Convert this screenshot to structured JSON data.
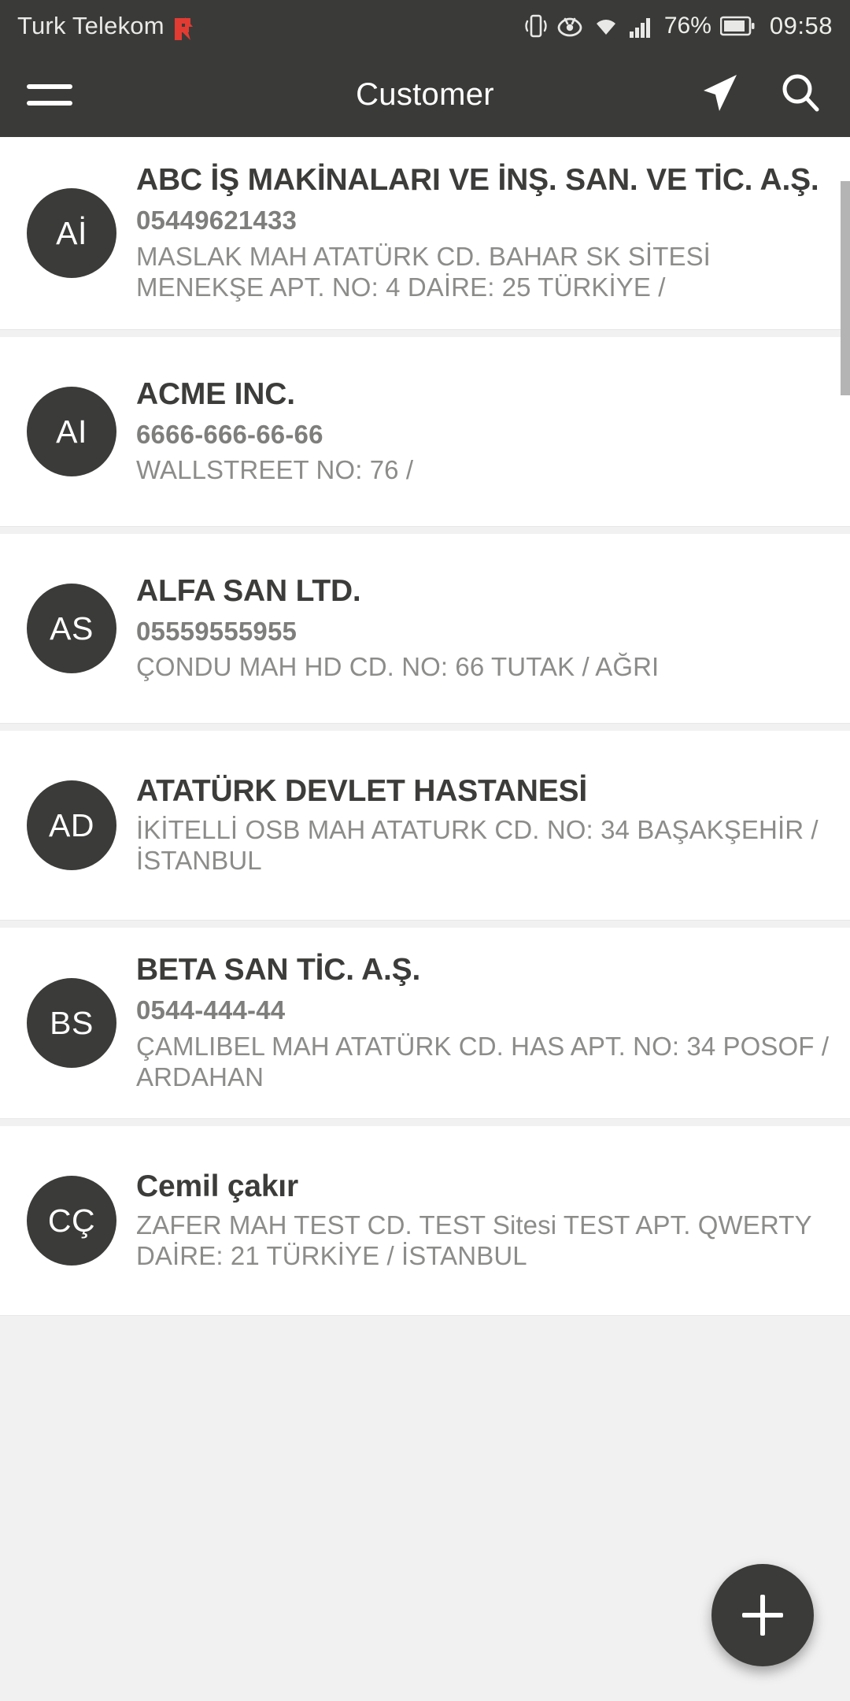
{
  "status_bar": {
    "carrier": "Turk Telekom",
    "carrier_badge_icon": "flash-f-icon",
    "icons": [
      "vibrate-icon",
      "eye-icon",
      "wifi-icon",
      "signal-bars-icon"
    ],
    "battery_percent": "76%",
    "battery_icon": "battery-icon",
    "time": "09:58"
  },
  "app_bar": {
    "menu_icon": "hamburger-menu-icon",
    "title": "Customer",
    "location_icon": "navigation-arrow-icon",
    "search_icon": "search-icon"
  },
  "fab": {
    "icon": "plus-icon",
    "label": "+"
  },
  "colors": {
    "app_bar_bg": "#3a3a38",
    "avatar_bg": "#3b3b39",
    "page_bg": "#f1f1f1",
    "card_bg": "#ffffff",
    "name_text": "#3c3c3a",
    "phone_text": "#7e7e7c",
    "address_text": "#8c8c8a",
    "carrier_badge": "#e23b32"
  },
  "customers": [
    {
      "initials": "Aİ",
      "name": "ABC İŞ MAKİNALARI VE İNŞ. SAN. VE TİC. A.Ş.",
      "phone": "05449621433",
      "address": "MASLAK MAH ATATÜRK CD. BAHAR  SK  SİTESİ MENEKŞE APT. NO: 4 DAİRE: 25 TÜRKİYE /"
    },
    {
      "initials": "AI",
      "name": "ACME INC.",
      "phone": "6666-666-66-66",
      "address": "WALLSTREET  NO: 76   /"
    },
    {
      "initials": "AS",
      "name": "ALFA SAN LTD.",
      "phone": "05559555955",
      "address": "ÇONDU MAH HD CD. NO: 66 TUTAK / AĞRI"
    },
    {
      "initials": "AD",
      "name": "ATATÜRK DEVLET HASTANESİ",
      "phone": "",
      "address": "İKİTELLİ OSB MAH ATATURK  CD. NO: 34 BAŞAKŞEHİR / İSTANBUL"
    },
    {
      "initials": "BS",
      "name": "BETA SAN TİC. A.Ş.",
      "phone": "0544-444-44",
      "address": "ÇAMLIBEL MAH ATATÜRK CD. HAS APT. NO: 34 POSOF / ARDAHAN"
    },
    {
      "initials": "CÇ",
      "name": "Cemil çakır",
      "phone": "",
      "address": "ZAFER MAH TEST CD. TEST Sitesi TEST APT. QWERTY DAİRE: 21 TÜRKİYE / İSTANBUL"
    }
  ]
}
